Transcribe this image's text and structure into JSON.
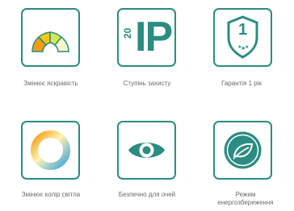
{
  "features": [
    {
      "icon": "brightness-gauge-icon",
      "label": "Змінює яскравість"
    },
    {
      "icon": "ip-rating-icon",
      "code": "IP",
      "code_number": "20",
      "label": "Ступінь захисту"
    },
    {
      "icon": "warranty-shield-icon",
      "badge": "1",
      "label": "Гарантія 1 рік"
    },
    {
      "icon": "color-ring-icon",
      "label": "Змінює колір світла"
    },
    {
      "icon": "eye-icon",
      "label": "Безпечно для очей"
    },
    {
      "icon": "leaf-icon",
      "label": "Режим енергозбереження"
    }
  ],
  "colors": {
    "accent": "#2b8c82",
    "caption": "#6a6a6a"
  }
}
